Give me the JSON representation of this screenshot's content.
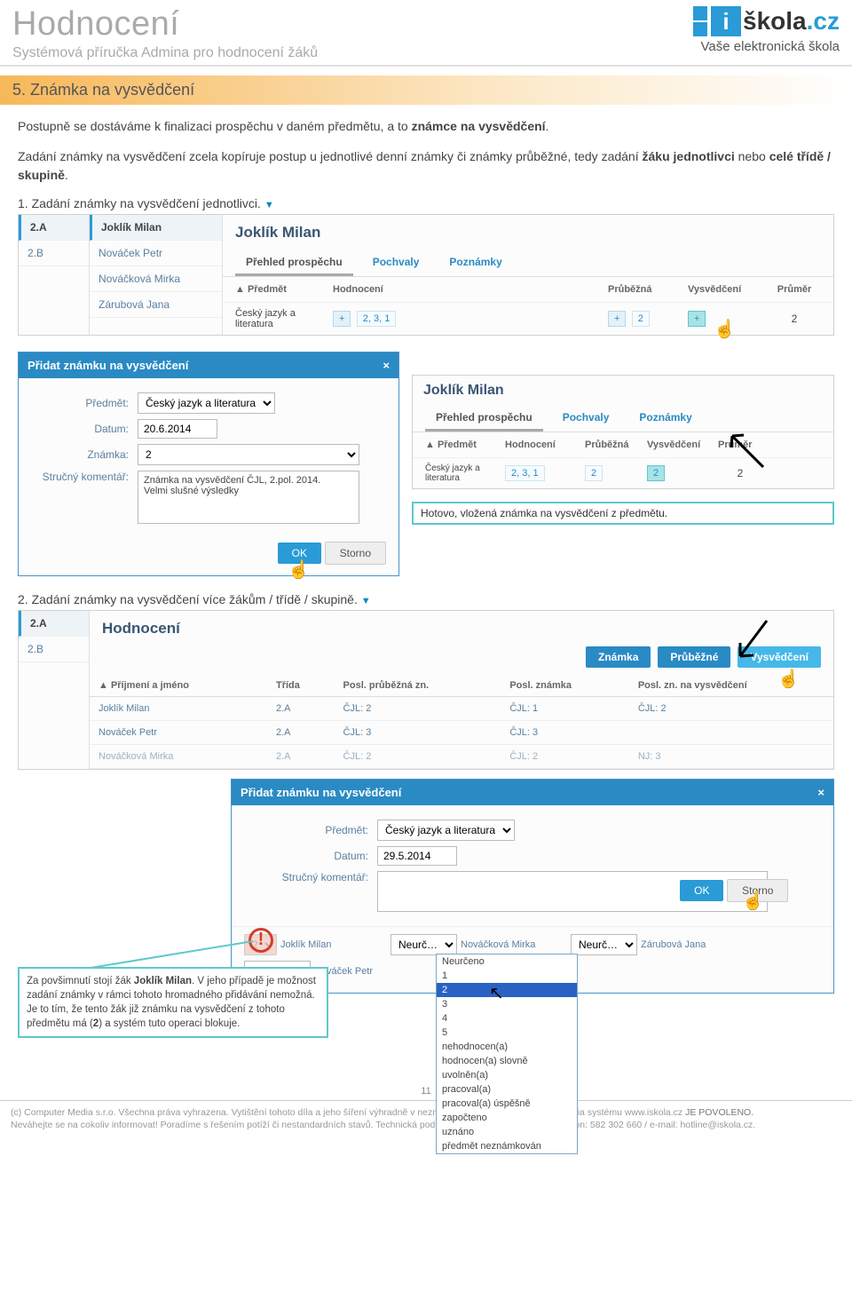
{
  "header": {
    "title": "Hodnocení",
    "subtitle": "Systémová příručka Admina pro hodnocení žáků",
    "logo_word1": "škola",
    "logo_word2": ".cz",
    "logo_i": "i",
    "tagline": "Vaše elektronická škola"
  },
  "section": {
    "title": "5. Známka na vysvědčení",
    "para1a": "Postupně se dostáváme k finalizaci prospěchu v daném předmětu, a to ",
    "para1b": "známce na vysvědčení",
    "para1c": ".",
    "para2a": "Zadání známky na vysvědčení zcela kopíruje postup u jednotlivé denní známky či známky průběžné, tedy zadání ",
    "para2b": "žáku jednotlivci",
    "para2c": " nebo ",
    "para2d": "celé třídě / skupině",
    "para2e": "."
  },
  "step1": {
    "label": "1. Zadání známky na vysvědčení jednotlivci.",
    "classes": [
      "2.A",
      "2.B"
    ],
    "students": [
      "Joklík Milan",
      "Nováček Petr",
      "Nováčková Mirka",
      "Zárubová Jana"
    ],
    "student_name": "Joklík Milan",
    "tabs": [
      "Přehled prospěchu",
      "Pochvaly",
      "Poznámky"
    ],
    "cols": {
      "predmet": "▲ Předmět",
      "hodnoceni": "Hodnocení",
      "prubezna": "Průběžná",
      "vysvedceni": "Vysvědčení",
      "prumer": "Průměr"
    },
    "subject": "Český jazyk a literatura",
    "marks": "2, 3, 1",
    "prubezna": "2",
    "avg": "2",
    "plus": "+"
  },
  "modal1": {
    "title": "Přidat známku na vysvědčení",
    "close": "×",
    "predmet_lbl": "Předmět:",
    "predmet_val": "Český jazyk a literatura",
    "datum_lbl": "Datum:",
    "datum_val": "20.6.2014",
    "znamka_lbl": "Známka:",
    "znamka_val": "2",
    "komentar_lbl": "Stručný komentář:",
    "komentar_val": "Známka na vysvědčení ČJL, 2.pol. 2014.\nVelmi slušné výsledky",
    "ok": "OK",
    "storno": "Storno"
  },
  "panel1b": {
    "student_name": "Joklík Milan",
    "tabs": [
      "Přehled prospěchu",
      "Pochvaly",
      "Poznámky"
    ],
    "cols": {
      "predmet": "▲ Předmět",
      "hodnoceni": "Hodnocení",
      "prubezna": "Průběžná",
      "vysvedceni": "Vysvědčení",
      "prumer": "Průměr"
    },
    "subject": "Český jazyk a literatura",
    "marks": "2, 3, 1",
    "prubezna": "2",
    "vysvedceni": "2",
    "avg": "2",
    "annot": "Hotovo, vložená známka na vysvědčení z předmětu."
  },
  "step2": {
    "label": "2. Zadání známky na vysvědčení více žákům / třídě / skupině.",
    "classes": [
      "2.A",
      "2.B"
    ],
    "title": "Hodnocení",
    "tabs": [
      "Známka",
      "Průběžné",
      "Vysvědčení"
    ],
    "cols": [
      "▲ Příjmení a jméno",
      "Třída",
      "Posl. průběžná zn.",
      "Posl. známka",
      "Posl. zn. na vysvědčení"
    ],
    "rows": [
      {
        "name": "Joklík Milan",
        "trida": "2.A",
        "pp": "ČJL: 2",
        "pz": "ČJL: 1",
        "pv": "ČJL: 2"
      },
      {
        "name": "Nováček Petr",
        "trida": "2.A",
        "pp": "ČJL: 3",
        "pz": "ČJL: 3",
        "pv": ""
      },
      {
        "name": "Nováčková Mirka",
        "trida": "2.A",
        "pp": "ČJL: 2",
        "pz": "ČJL: 2",
        "pv": "NJ: 3"
      }
    ]
  },
  "modal2": {
    "title": "Přidat známku na vysvědčení",
    "close": "×",
    "predmet_lbl": "Předmět:",
    "predmet_val": "Český jazyk a literatura",
    "datum_lbl": "Datum:",
    "datum_val": "29.5.2014",
    "komentar_lbl": "Stručný komentář:",
    "students": [
      {
        "val": "2",
        "name": "Joklík Milan"
      },
      {
        "val": "Neurč…",
        "name": "Nováček Petr"
      },
      {
        "val": "Neurč…",
        "name": "Nováčková Mirka"
      },
      {
        "val": "Neurč…",
        "name": "Zárubová Jana"
      }
    ],
    "dropdown": [
      "Neurčeno",
      "1",
      "2",
      "3",
      "4",
      "5",
      "nehodnocen(a)",
      "hodnocen(a) slovně",
      "uvolněn(a)",
      "pracoval(a)",
      "pracoval(a) úspěšně",
      "započteno",
      "uznáno",
      "předmět neznámkován"
    ],
    "ok": "OK",
    "storno": "Storno"
  },
  "callout": {
    "p1a": "Za povšimnutí stojí žák ",
    "p1b": "Joklík Milan",
    "p1c": ". V jeho případě je možnost zadání známky v rámci tohoto hromadného přidávání nemožná. Je to tím, že tento žák již známku na vysvědčení z tohoto předmětu má (",
    "p1d": "2",
    "p1e": ") a systém tuto operaci blokuje.",
    "bang": "!"
  },
  "page_num": "11",
  "footer": {
    "line1a": "(c) Computer Media s.r.o. Všechna práva vyhrazena. Vytištění tohoto díla a jeho šíření výhradně v nezměněné podobě a pro potřeby studia systému www.iskola.cz ",
    "line1b": "JE POVOLENO.",
    "line2": "Neváhejte se na cokoliv informovat! Poradíme s řešením potíží či nestandardních stavů. Technická podpora systému www.iskola.cz: telefon: 582 302 660 / e-mail: hotline@iskola.cz."
  }
}
